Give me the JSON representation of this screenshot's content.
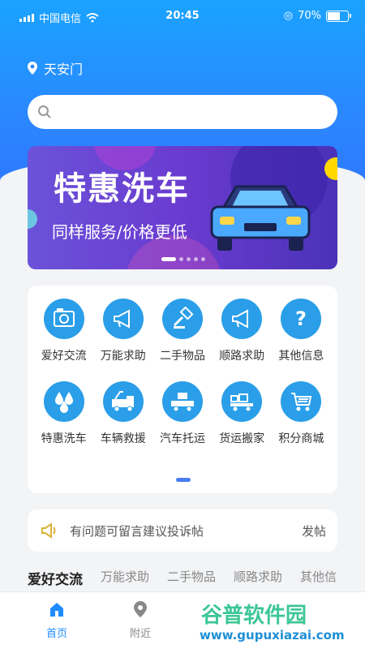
{
  "status": {
    "carrier": "中国电信",
    "time": "20:45",
    "battery": "70%",
    "battery_level": 0.7
  },
  "location": "天安门",
  "search": {
    "placeholder": ""
  },
  "banner": {
    "title": "特惠洗车",
    "subtitle": "同样服务/价格更低"
  },
  "categories": [
    {
      "label": "爱好交流",
      "icon": "camera-icon"
    },
    {
      "label": "万能求助",
      "icon": "megaphone-icon"
    },
    {
      "label": "二手物品",
      "icon": "hammer-icon"
    },
    {
      "label": "顺路求助",
      "icon": "megaphone-icon"
    },
    {
      "label": "其他信息",
      "icon": "question-icon"
    },
    {
      "label": "特惠洗车",
      "icon": "drops-icon"
    },
    {
      "label": "车辆救援",
      "icon": "tow-truck-icon"
    },
    {
      "label": "汽车托运",
      "icon": "truck-icon"
    },
    {
      "label": "货运搬家",
      "icon": "cargo-icon"
    },
    {
      "label": "积分商城",
      "icon": "cart-icon"
    }
  ],
  "notice": {
    "text": "有问题可留言建议投诉帖",
    "post": "发帖"
  },
  "tabs": [
    "爱好交流",
    "万能求助",
    "二手物品",
    "顺路求助",
    "其他信"
  ],
  "tabbar": [
    {
      "label": "首页",
      "icon": "home-icon"
    },
    {
      "label": "附近",
      "icon": "location-icon"
    }
  ],
  "watermark": {
    "brand": "谷普软件园",
    "url": "www.gupuxiazai.com"
  },
  "colors": {
    "primary": "#2b86ff",
    "accent": "#1e8cff",
    "icon_bg": "#2a9ee8"
  }
}
